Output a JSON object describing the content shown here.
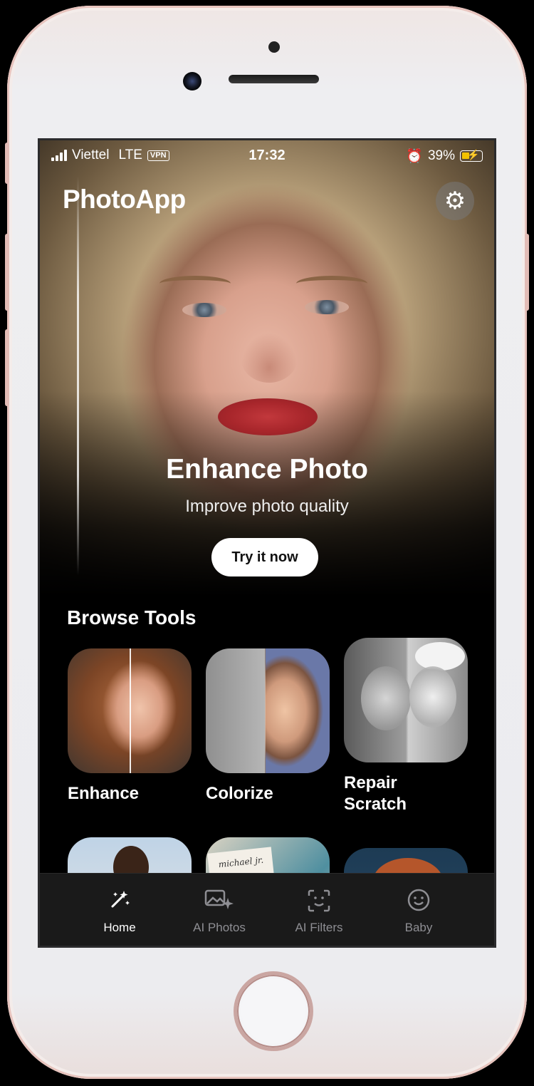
{
  "status_bar": {
    "carrier": "Viettel",
    "network": "LTE",
    "vpn": "VPN",
    "time": "17:32",
    "battery": "39%"
  },
  "header": {
    "app_title": "PhotoApp",
    "settings_icon": "gear-icon"
  },
  "hero": {
    "title": "Enhance Photo",
    "subtitle": "Improve photo quality",
    "cta_label": "Try it now"
  },
  "browse": {
    "section_title": "Browse Tools",
    "tools": [
      {
        "label": "Enhance"
      },
      {
        "label": "Colorize"
      },
      {
        "label": "Repair\nScratch"
      }
    ],
    "row2_note_text": "michael jr."
  },
  "tabbar": {
    "items": [
      {
        "label": "Home",
        "icon": "magic-wand-icon",
        "active": true
      },
      {
        "label": "AI Photos",
        "icon": "ai-photos-icon",
        "active": false
      },
      {
        "label": "AI Filters",
        "icon": "face-scan-icon",
        "active": false
      },
      {
        "label": "Baby",
        "icon": "smiley-icon",
        "active": false
      }
    ]
  },
  "colors": {
    "background": "#000000",
    "tabbar_bg": "#1a1a1a",
    "active_tab": "#ffffff",
    "inactive_tab": "#8e8e93",
    "battery_charging": "#f2c200"
  }
}
